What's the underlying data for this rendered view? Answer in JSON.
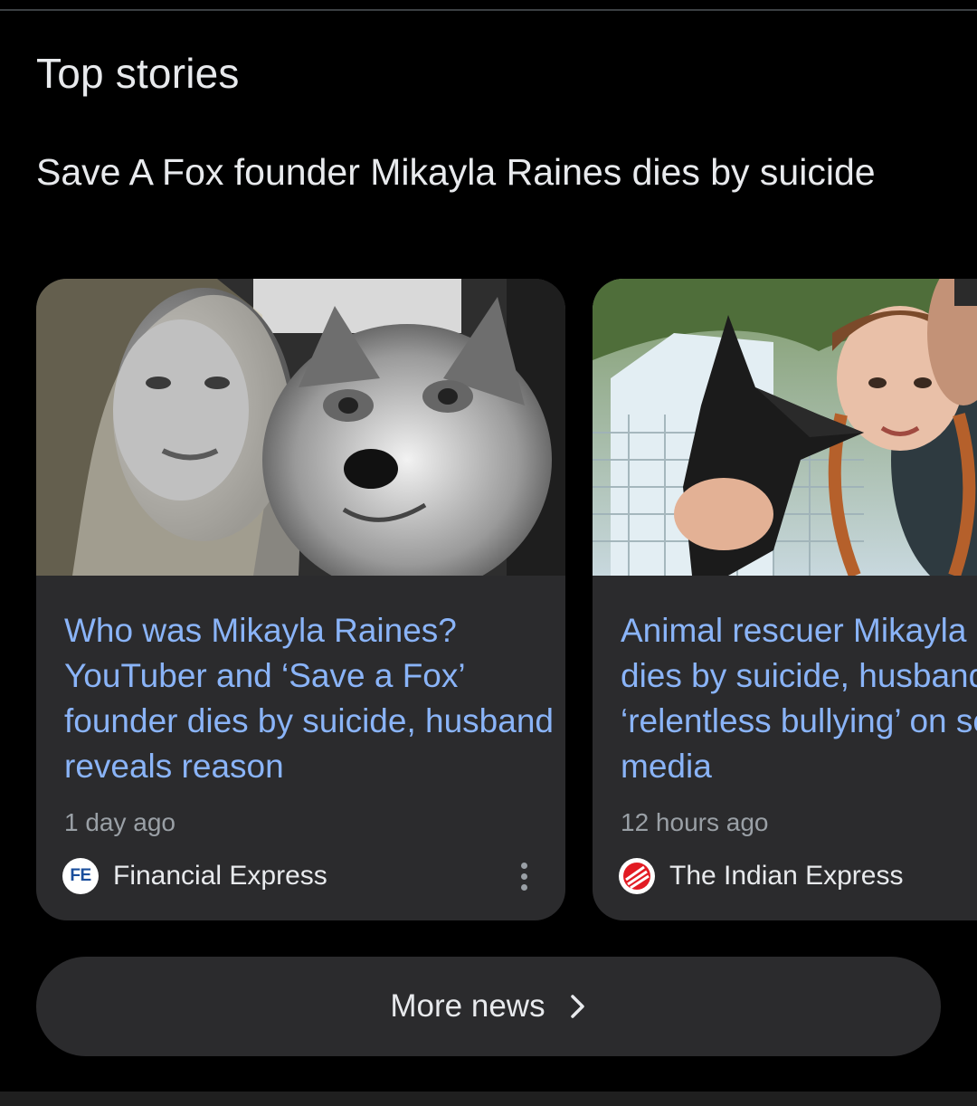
{
  "section": {
    "title": "Top stories"
  },
  "cluster": {
    "headline": "Save A Fox founder Mikayla Raines dies by suicide"
  },
  "cards": [
    {
      "headline": "Who was Mikayla Raines? YouTuber and ‘Save a Fox’ founder dies by suicide, husband reveals reason",
      "time": "1 day ago",
      "source": "Financial Express",
      "logo_text": "FE"
    },
    {
      "headline": "Animal rescuer Mikayla Raines dies by suicide, husband blames ‘relentless bullying’ on social media",
      "time": "12 hours ago",
      "source": "The Indian Express"
    }
  ],
  "more_news": {
    "label": "More news"
  },
  "icons": {
    "more_menu": "more-vert-icon",
    "chevron": "chevron-right-icon",
    "ie_logo": "indian-express-logo-icon"
  },
  "colors": {
    "background": "#000000",
    "card": "#2b2b2d",
    "link": "#8ab4f8",
    "text": "#e8eaed",
    "muted": "#9aa0a6"
  }
}
